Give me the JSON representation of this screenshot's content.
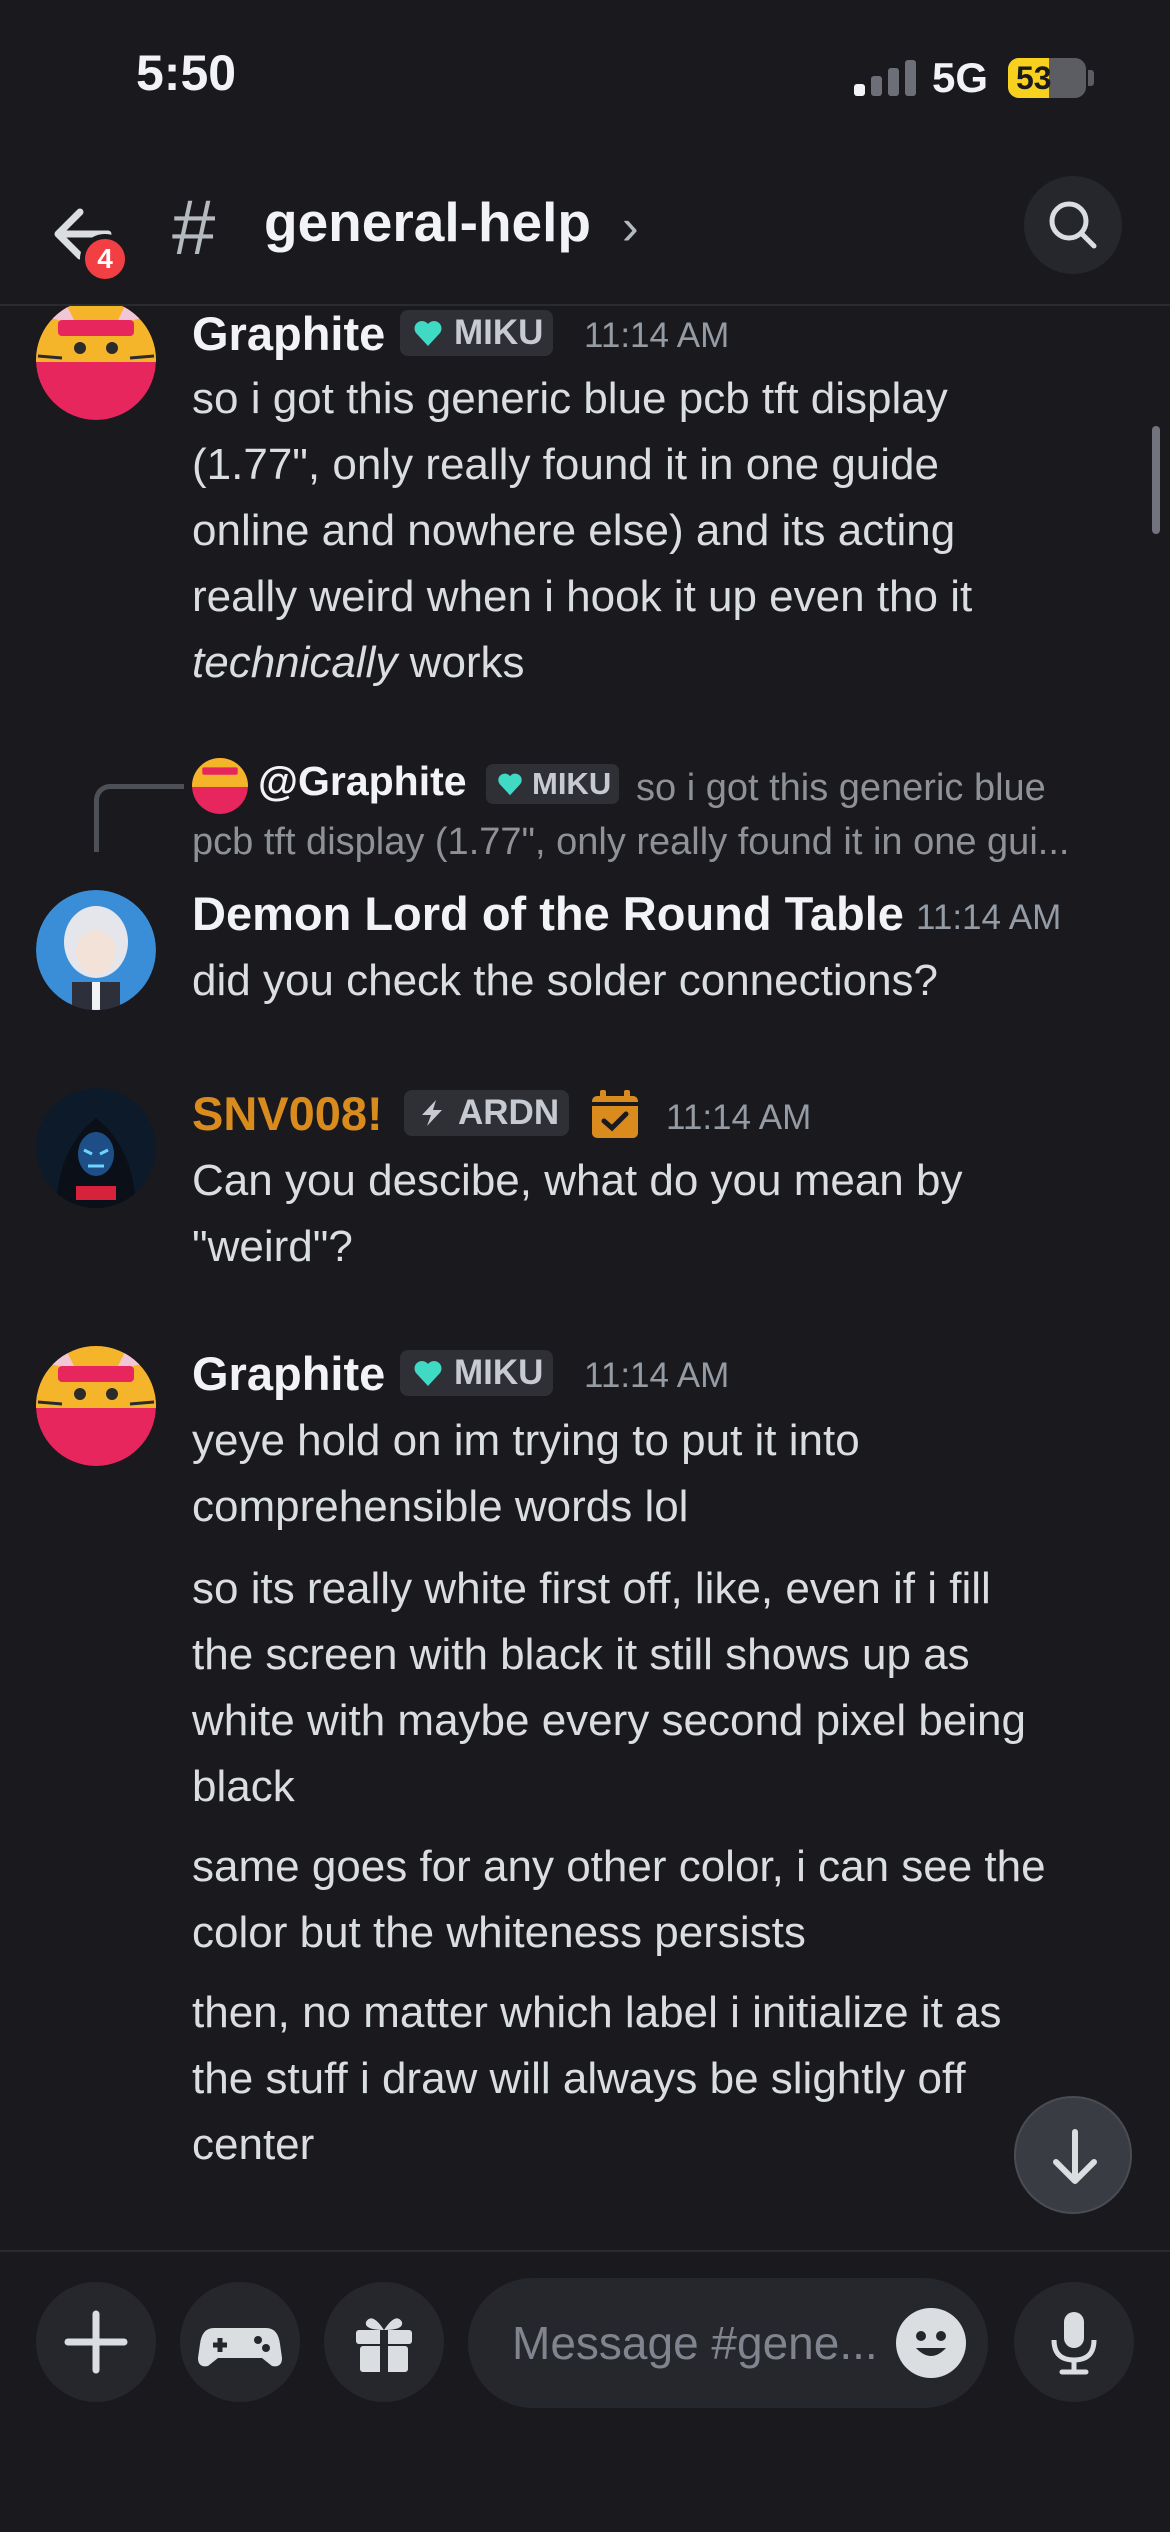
{
  "status": {
    "time": "5:50",
    "network": "5G",
    "battery": "53",
    "battery_level": 0.53
  },
  "header": {
    "back_badge": "4",
    "channel_name": "general-help",
    "chevron": "›"
  },
  "messages": [
    {
      "author": "Graphite",
      "tag": "MIKU",
      "time": "11:14 AM",
      "lines": [
        "so i got this generic blue pcb tft display",
        "(1.77\", only really found it in one guide",
        "online and nowhere else) and its acting",
        "really weird when i hook it up even tho it"
      ],
      "last_line_em": "technically",
      "last_line_rest": " works"
    },
    {
      "reply_author": "@Graphite",
      "reply_tag": "MIKU",
      "reply_text_1": "so i got this generic blue",
      "reply_text_2": "pcb tft display (1.77\", only really found it in one gui...",
      "author": "Demon Lord of the Round Table",
      "time": "11:14 AM",
      "text": "did you check the solder connections?"
    },
    {
      "author": "SNV008!",
      "author_color": "#d98c1d",
      "tag": "ARDN",
      "time": "11:14 AM",
      "lines": [
        "Can you descibe, what do you mean by",
        "\"weird\"?"
      ]
    },
    {
      "author": "Graphite",
      "tag": "MIKU",
      "time": "11:14 AM",
      "paragraphs": [
        [
          "yeye hold on im trying to put it into",
          "comprehensible words lol"
        ],
        [
          "so its really white first off, like, even if i fill",
          "the screen with black it still shows up as",
          "white with maybe every second pixel being",
          "black"
        ],
        [
          "same goes for any other color, i can see the",
          "color but the whiteness persists"
        ],
        [
          "then, no matter which label i initialize it as",
          "the stuff i draw will always be slightly off",
          "center"
        ]
      ]
    }
  ],
  "composer": {
    "placeholder": "Message #gene..."
  },
  "icons": {
    "back": "arrow-left-icon",
    "search": "search-icon",
    "add": "plus-icon",
    "games": "gamepad-icon",
    "gift": "gift-icon",
    "emoji": "emoji-icon",
    "mic": "microphone-icon",
    "scroll": "arrow-down-icon"
  },
  "colors": {
    "background": "#1a1a1e",
    "accent_red": "#f23f43",
    "miku_teal": "#3fd9c4",
    "snv_orange": "#d98c1d"
  }
}
